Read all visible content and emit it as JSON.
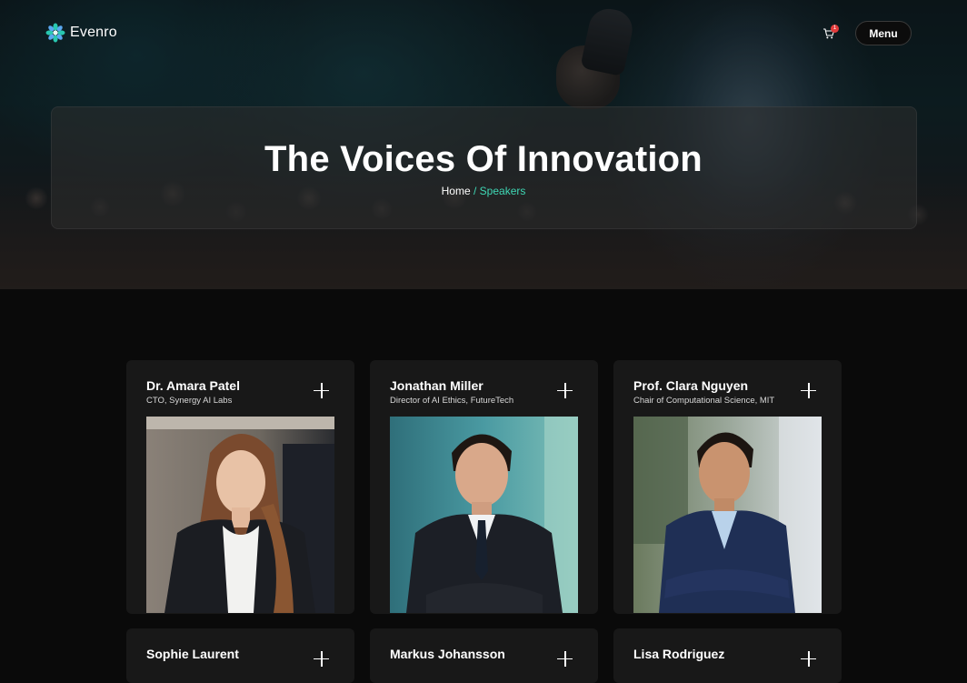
{
  "brand": {
    "name": "Evenro",
    "logo_icon": "flower-logo-icon",
    "accent": "#3fd8b5"
  },
  "nav": {
    "menu_label": "Menu",
    "cart_icon": "cart-icon",
    "cart_count": "1"
  },
  "hero": {
    "title": "The Voices Of Innovation",
    "breadcrumb": {
      "home": "Home",
      "separator": "/",
      "current": "Speakers"
    }
  },
  "speakers": [
    {
      "name": "Dr. Amara Patel",
      "role": "CTO, Synergy AI Labs"
    },
    {
      "name": "Jonathan Miller",
      "role": "Director of AI Ethics, FutureTech"
    },
    {
      "name": "Prof. Clara Nguyen",
      "role": "Chair of Computational Science, MIT"
    },
    {
      "name": "Sophie Laurent",
      "role": ""
    },
    {
      "name": "Markus Johansson",
      "role": ""
    },
    {
      "name": "Lisa Rodriguez",
      "role": ""
    }
  ]
}
